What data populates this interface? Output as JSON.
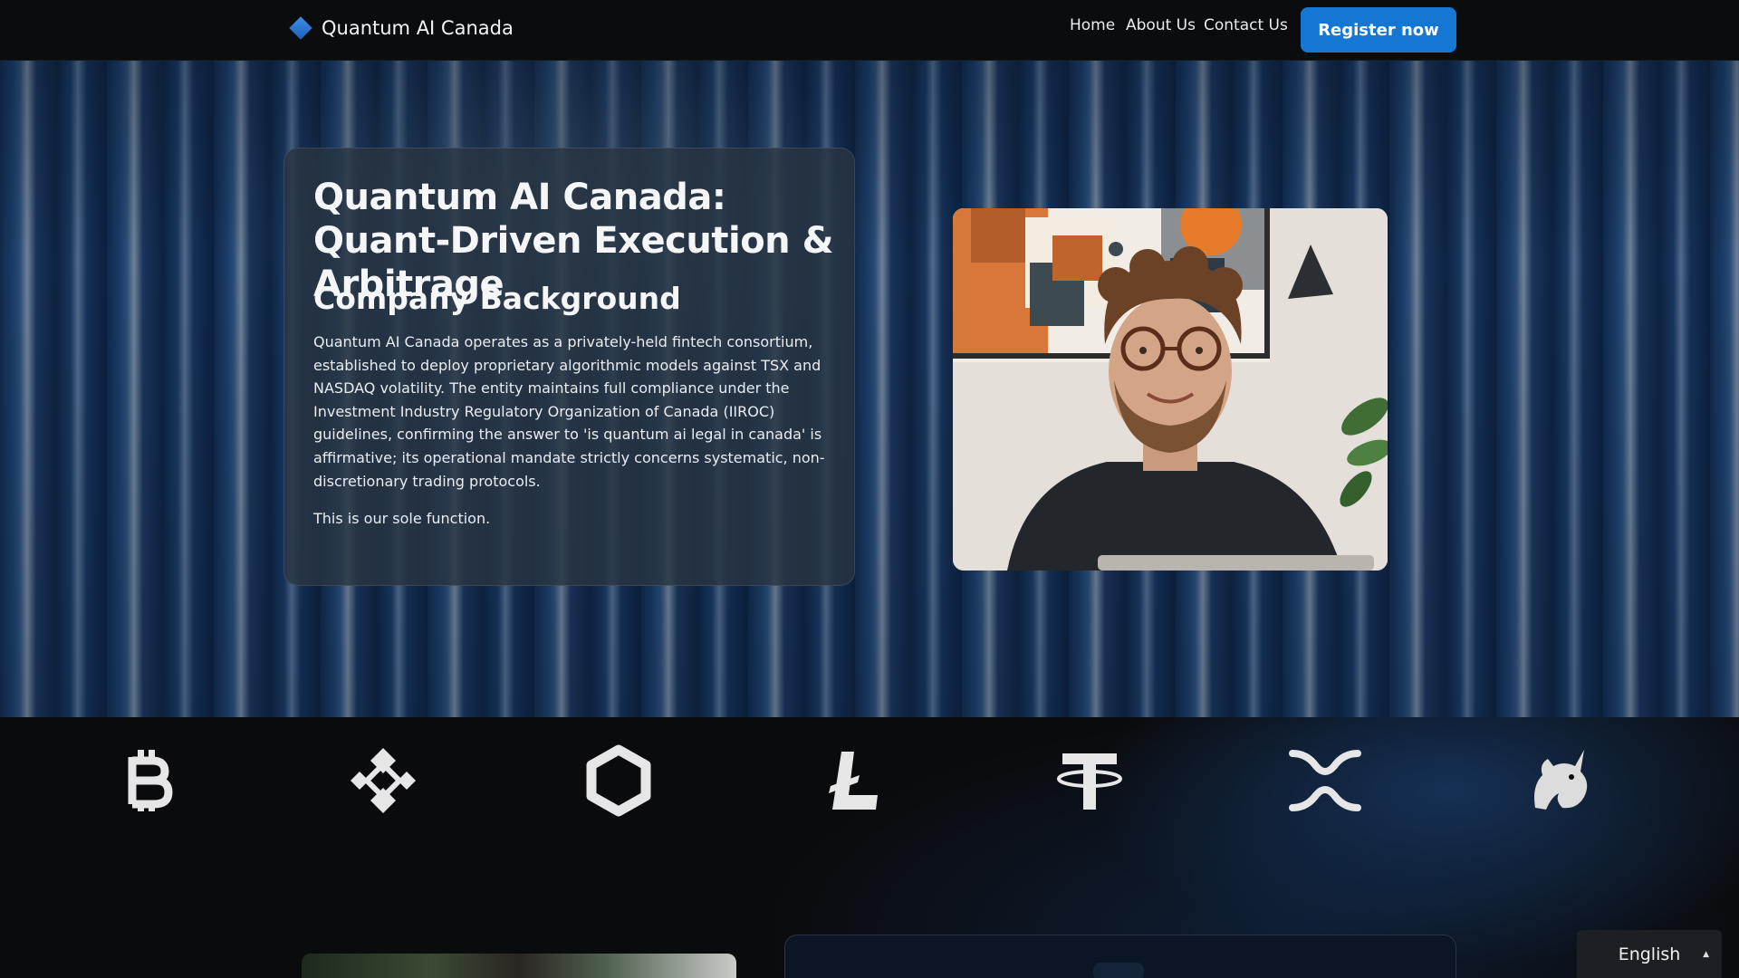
{
  "header": {
    "brand_name": "Quantum AI Canada",
    "nav": {
      "home": "Home",
      "about": "About Us",
      "contact": "Contact Us"
    },
    "register_label": "Register now"
  },
  "hero": {
    "title": "Quantum AI Canada: Quant-Driven Execution & Arbitrage",
    "subtitle": "Company Background",
    "paragraph_1": "Quantum AI Canada operates as a privately-held fintech consortium, established to deploy proprietary algorithmic models against TSX and NASDAQ volatility. The entity maintains full compliance under the Investment Industry Regulatory Organization of Canada (IIROC) guidelines, confirming the answer to 'is quantum ai legal in canada' is affirmative; its operational mandate strictly concerns systematic, non-discretionary trading protocols.",
    "paragraph_2": "This is our sole function.",
    "photo_icon": "smiling-man-photo"
  },
  "coins": [
    {
      "name": "bitcoin",
      "icon": "bitcoin-icon"
    },
    {
      "name": "binance",
      "icon": "binance-icon"
    },
    {
      "name": "chainlink",
      "icon": "chainlink-icon"
    },
    {
      "name": "litecoin",
      "icon": "litecoin-icon"
    },
    {
      "name": "tether",
      "icon": "tether-icon"
    },
    {
      "name": "xrp",
      "icon": "xrp-icon"
    },
    {
      "name": "uniswap",
      "icon": "uniswap-icon"
    }
  ],
  "language_selector": {
    "value": "English"
  },
  "colors": {
    "accent": "#1577d4",
    "nav_bg": "#0b0c0e",
    "card_bg": "#28343f"
  }
}
